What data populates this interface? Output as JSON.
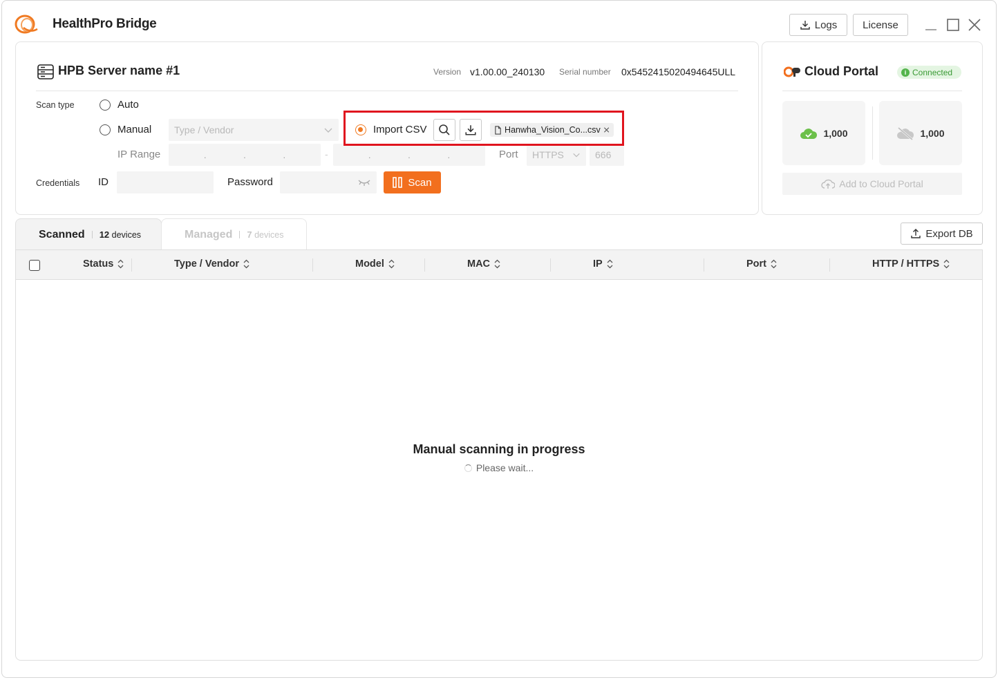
{
  "app": {
    "title": "HealthPro Bridge",
    "logs_label": "Logs",
    "license_label": "License"
  },
  "server": {
    "name": "HPB Server name #1",
    "version_label": "Version",
    "version_value": "v1.00.00_240130",
    "serial_label": "Serial number",
    "serial_value": "0x5452415020494645ULL",
    "scan_type_label": "Scan type",
    "options": {
      "auto": "Auto",
      "manual": "Manual",
      "import_csv": "Import CSV"
    },
    "selected_option": "import_csv",
    "type_vendor_placeholder": "Type / Vendor",
    "ip_range_label": "IP Range",
    "ip_separator": "-",
    "port_label": "Port",
    "port_protocol": "HTTPS",
    "port_value": "666",
    "csv_file": "Hanwha_Vision_Co...csv",
    "credentials_label": "Credentials",
    "id_label": "ID",
    "password_label": "Password",
    "scan_label": "Scan"
  },
  "cloud": {
    "title": "Cloud Portal",
    "status": "Connected",
    "online_count": "1,000",
    "offline_count": "1,000",
    "add_label": "Add to Cloud Portal"
  },
  "tabs": [
    {
      "name": "Scanned",
      "count": "12",
      "unit": "devices",
      "active": true
    },
    {
      "name": "Managed",
      "count": "7",
      "unit": "devices",
      "active": false
    }
  ],
  "export_label": "Export DB",
  "table": {
    "columns": [
      "Status",
      "Type / Vendor",
      "Model",
      "MAC",
      "IP",
      "Port",
      "HTTP / HTTPS"
    ]
  },
  "progress": {
    "title": "Manual scanning in progress",
    "subtitle": "Please wait..."
  },
  "colors": {
    "accent": "#f26f1e",
    "highlight": "#e0141e",
    "connected": "#3a9a35"
  }
}
